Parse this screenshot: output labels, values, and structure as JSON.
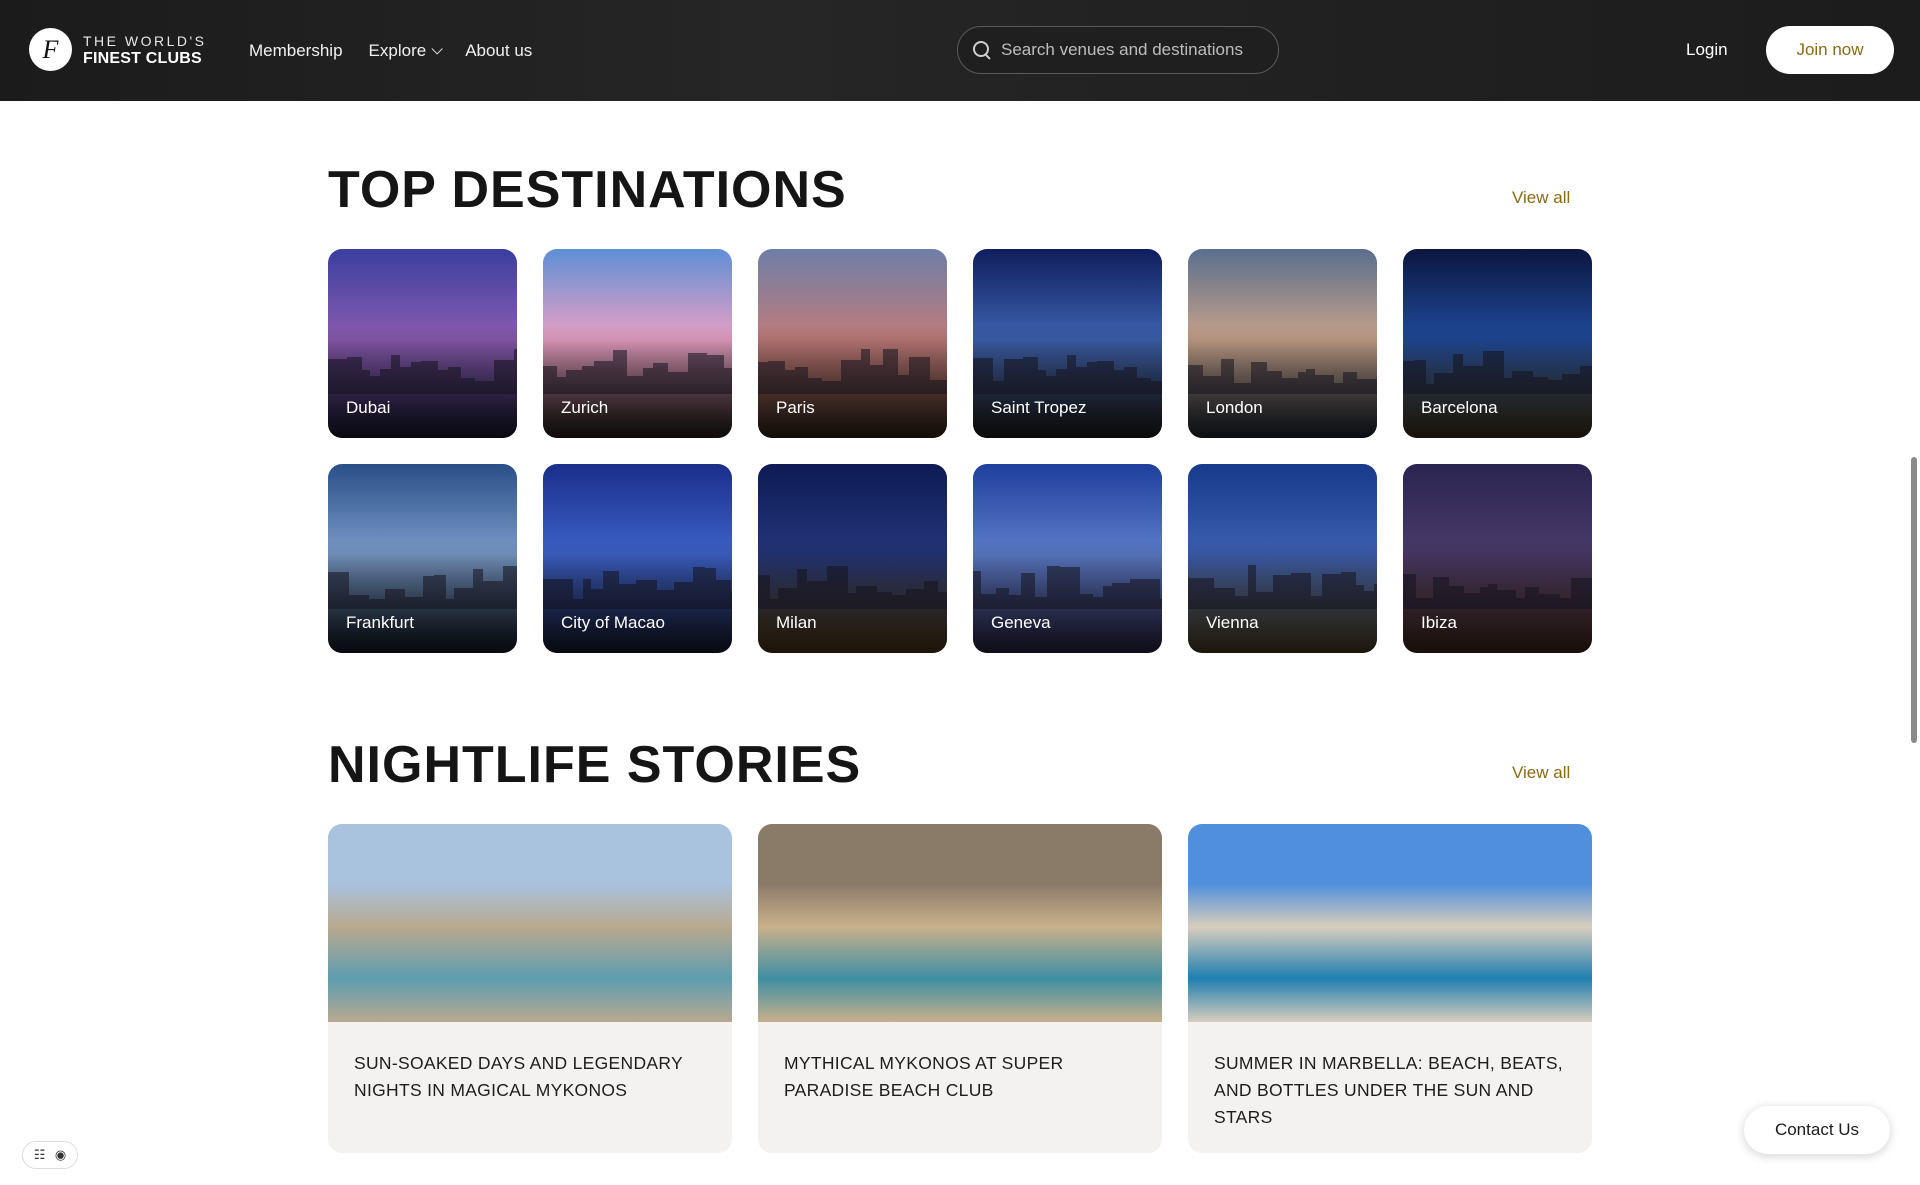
{
  "header": {
    "logo_line1": "THE WORLD'S",
    "logo_line2": "FINEST CLUBS",
    "logo_mark": "F",
    "nav": [
      "Membership",
      "Explore",
      "About us"
    ],
    "search_placeholder": "Search venues and destinations",
    "login_label": "Login",
    "join_label": "Join now"
  },
  "destinations": {
    "title": "TOP DESTINATIONS",
    "view_all": "View all",
    "items": [
      {
        "name": "Dubai",
        "sky": "#3a3f9e",
        "mid": "#8a5bb0",
        "ground": "#24244a"
      },
      {
        "name": "Zurich",
        "sky": "#5e8fd6",
        "mid": "#e9a0c4",
        "ground": "#3a2f2a"
      },
      {
        "name": "Paris",
        "sky": "#6d7fa8",
        "mid": "#c07b7a",
        "ground": "#4a3321"
      },
      {
        "name": "Saint Tropez",
        "sky": "#0f1d5c",
        "mid": "#3d62b0",
        "ground": "#2a2a2a"
      },
      {
        "name": "London",
        "sky": "#5a6e8e",
        "mid": "#c8a28a",
        "ground": "#2f3a48"
      },
      {
        "name": "Barcelona",
        "sky": "#0b1640",
        "mid": "#1f4a9a",
        "ground": "#5a4a2a"
      },
      {
        "name": "Frankfurt",
        "sky": "#2a4f88",
        "mid": "#7a9ac8",
        "ground": "#1e2a3a"
      },
      {
        "name": "City of Macao",
        "sky": "#1b2e8a",
        "mid": "#3d62c9",
        "ground": "#20284a"
      },
      {
        "name": "Milan",
        "sky": "#0d1a54",
        "mid": "#23357a",
        "ground": "#6a5020"
      },
      {
        "name": "Geneva",
        "sky": "#1f3f9e",
        "mid": "#5c7cc9",
        "ground": "#3a3460"
      },
      {
        "name": "Vienna",
        "sky": "#183a8a",
        "mid": "#3d5fb0",
        "ground": "#6a5a30"
      },
      {
        "name": "Ibiza",
        "sky": "#2a2450",
        "mid": "#4a3a6a",
        "ground": "#5a3a2a"
      }
    ]
  },
  "stories": {
    "title": "NIGHTLIFE STORIES",
    "view_all": "View all",
    "items": [
      {
        "title": "SUN-SOAKED DAYS AND LEGENDARY NIGHTS IN MAGICAL MYKONOS",
        "sky": "#a9c2de",
        "sea": "#5e9db0",
        "land": "#b9a98f"
      },
      {
        "title": "MYTHICAL MYKONOS AT SUPER PARADISE BEACH CLUB",
        "sky": "#8a7a68",
        "sea": "#3f8fa3",
        "land": "#c8b08a"
      },
      {
        "title": "SUMMER IN MARBELLA: BEACH, BEATS, AND BOTTLES UNDER THE SUN AND STARS",
        "sky": "#4f8fdc",
        "sea": "#1f7fb0",
        "land": "#d8cdbd"
      }
    ]
  },
  "floating": {
    "contact_label": "Contact Us",
    "cookie_icon": "cookie-icon",
    "list_icon": "checklist-icon"
  }
}
